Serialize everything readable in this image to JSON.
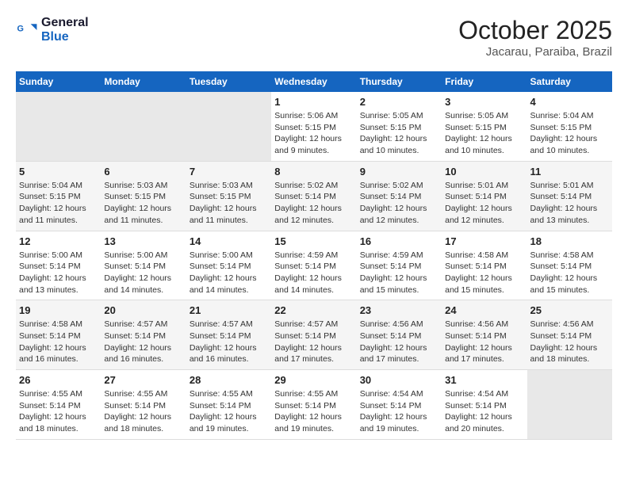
{
  "logo": {
    "line1": "General",
    "line2": "Blue"
  },
  "title": "October 2025",
  "location": "Jacarau, Paraiba, Brazil",
  "weekdays": [
    "Sunday",
    "Monday",
    "Tuesday",
    "Wednesday",
    "Thursday",
    "Friday",
    "Saturday"
  ],
  "weeks": [
    [
      {
        "day": "",
        "info": ""
      },
      {
        "day": "",
        "info": ""
      },
      {
        "day": "",
        "info": ""
      },
      {
        "day": "1",
        "info": "Sunrise: 5:06 AM\nSunset: 5:15 PM\nDaylight: 12 hours\nand 9 minutes."
      },
      {
        "day": "2",
        "info": "Sunrise: 5:05 AM\nSunset: 5:15 PM\nDaylight: 12 hours\nand 10 minutes."
      },
      {
        "day": "3",
        "info": "Sunrise: 5:05 AM\nSunset: 5:15 PM\nDaylight: 12 hours\nand 10 minutes."
      },
      {
        "day": "4",
        "info": "Sunrise: 5:04 AM\nSunset: 5:15 PM\nDaylight: 12 hours\nand 10 minutes."
      }
    ],
    [
      {
        "day": "5",
        "info": "Sunrise: 5:04 AM\nSunset: 5:15 PM\nDaylight: 12 hours\nand 11 minutes."
      },
      {
        "day": "6",
        "info": "Sunrise: 5:03 AM\nSunset: 5:15 PM\nDaylight: 12 hours\nand 11 minutes."
      },
      {
        "day": "7",
        "info": "Sunrise: 5:03 AM\nSunset: 5:15 PM\nDaylight: 12 hours\nand 11 minutes."
      },
      {
        "day": "8",
        "info": "Sunrise: 5:02 AM\nSunset: 5:14 PM\nDaylight: 12 hours\nand 12 minutes."
      },
      {
        "day": "9",
        "info": "Sunrise: 5:02 AM\nSunset: 5:14 PM\nDaylight: 12 hours\nand 12 minutes."
      },
      {
        "day": "10",
        "info": "Sunrise: 5:01 AM\nSunset: 5:14 PM\nDaylight: 12 hours\nand 12 minutes."
      },
      {
        "day": "11",
        "info": "Sunrise: 5:01 AM\nSunset: 5:14 PM\nDaylight: 12 hours\nand 13 minutes."
      }
    ],
    [
      {
        "day": "12",
        "info": "Sunrise: 5:00 AM\nSunset: 5:14 PM\nDaylight: 12 hours\nand 13 minutes."
      },
      {
        "day": "13",
        "info": "Sunrise: 5:00 AM\nSunset: 5:14 PM\nDaylight: 12 hours\nand 14 minutes."
      },
      {
        "day": "14",
        "info": "Sunrise: 5:00 AM\nSunset: 5:14 PM\nDaylight: 12 hours\nand 14 minutes."
      },
      {
        "day": "15",
        "info": "Sunrise: 4:59 AM\nSunset: 5:14 PM\nDaylight: 12 hours\nand 14 minutes."
      },
      {
        "day": "16",
        "info": "Sunrise: 4:59 AM\nSunset: 5:14 PM\nDaylight: 12 hours\nand 15 minutes."
      },
      {
        "day": "17",
        "info": "Sunrise: 4:58 AM\nSunset: 5:14 PM\nDaylight: 12 hours\nand 15 minutes."
      },
      {
        "day": "18",
        "info": "Sunrise: 4:58 AM\nSunset: 5:14 PM\nDaylight: 12 hours\nand 15 minutes."
      }
    ],
    [
      {
        "day": "19",
        "info": "Sunrise: 4:58 AM\nSunset: 5:14 PM\nDaylight: 12 hours\nand 16 minutes."
      },
      {
        "day": "20",
        "info": "Sunrise: 4:57 AM\nSunset: 5:14 PM\nDaylight: 12 hours\nand 16 minutes."
      },
      {
        "day": "21",
        "info": "Sunrise: 4:57 AM\nSunset: 5:14 PM\nDaylight: 12 hours\nand 16 minutes."
      },
      {
        "day": "22",
        "info": "Sunrise: 4:57 AM\nSunset: 5:14 PM\nDaylight: 12 hours\nand 17 minutes."
      },
      {
        "day": "23",
        "info": "Sunrise: 4:56 AM\nSunset: 5:14 PM\nDaylight: 12 hours\nand 17 minutes."
      },
      {
        "day": "24",
        "info": "Sunrise: 4:56 AM\nSunset: 5:14 PM\nDaylight: 12 hours\nand 17 minutes."
      },
      {
        "day": "25",
        "info": "Sunrise: 4:56 AM\nSunset: 5:14 PM\nDaylight: 12 hours\nand 18 minutes."
      }
    ],
    [
      {
        "day": "26",
        "info": "Sunrise: 4:55 AM\nSunset: 5:14 PM\nDaylight: 12 hours\nand 18 minutes."
      },
      {
        "day": "27",
        "info": "Sunrise: 4:55 AM\nSunset: 5:14 PM\nDaylight: 12 hours\nand 18 minutes."
      },
      {
        "day": "28",
        "info": "Sunrise: 4:55 AM\nSunset: 5:14 PM\nDaylight: 12 hours\nand 19 minutes."
      },
      {
        "day": "29",
        "info": "Sunrise: 4:55 AM\nSunset: 5:14 PM\nDaylight: 12 hours\nand 19 minutes."
      },
      {
        "day": "30",
        "info": "Sunrise: 4:54 AM\nSunset: 5:14 PM\nDaylight: 12 hours\nand 19 minutes."
      },
      {
        "day": "31",
        "info": "Sunrise: 4:54 AM\nSunset: 5:14 PM\nDaylight: 12 hours\nand 20 minutes."
      },
      {
        "day": "",
        "info": ""
      }
    ]
  ]
}
